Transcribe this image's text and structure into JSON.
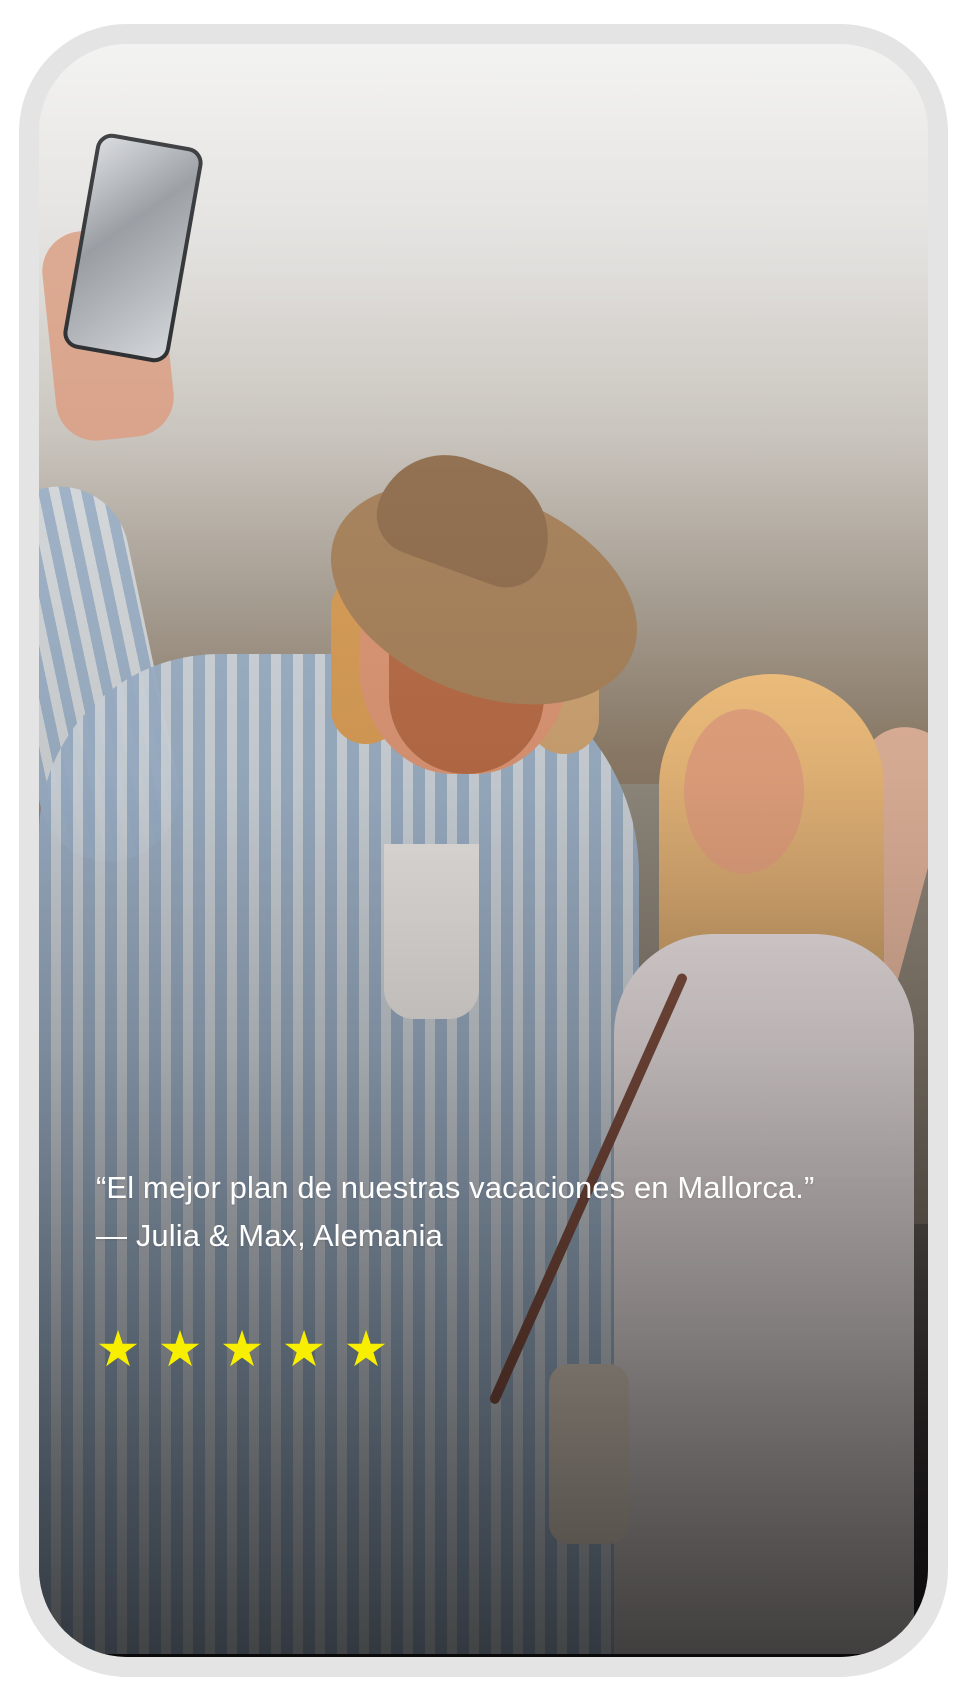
{
  "testimonial": {
    "quote": "“El mejor plan de nuestras vacaciones en Mallorca.”",
    "author": "— Julia & Max, Alemania",
    "rating": 5,
    "star_symbol": "★"
  },
  "colors": {
    "frame": "#e4e4e4",
    "star": "#f8ef00",
    "text": "#ffffff"
  },
  "icons": {
    "star": "star-icon"
  }
}
